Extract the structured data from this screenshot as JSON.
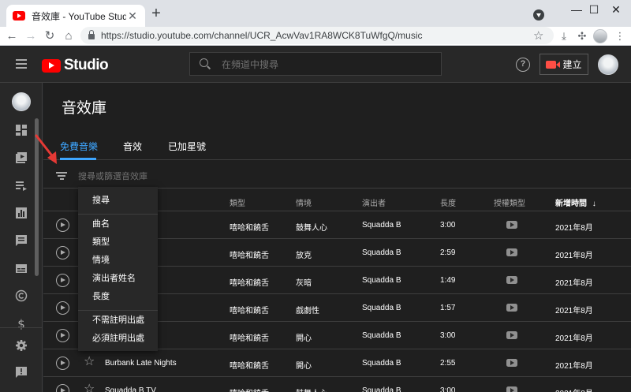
{
  "browser": {
    "tab_title": "音效庫 - YouTube Studio",
    "new_tab": "+",
    "win_min": "—",
    "win_max": "☐",
    "win_close": "✕",
    "url": "https://studio.youtube.com/channel/UCR_AcwVav1RA8WCK8TuWfgQ/music"
  },
  "header": {
    "logo_text": "Studio",
    "search_placeholder": "在頻道中搜尋",
    "create_label": "建立"
  },
  "page": {
    "title": "音效庫"
  },
  "tabs": [
    {
      "label": "免費音樂",
      "active": true
    },
    {
      "label": "音效",
      "active": false
    },
    {
      "label": "已加星號",
      "active": false
    }
  ],
  "filter": {
    "placeholder": "搜尋或篩選音效庫"
  },
  "columns": {
    "genre": "類型",
    "mood": "情境",
    "artist": "演出者",
    "duration": "長度",
    "license": "授權類型",
    "added": "新增時間"
  },
  "rows": [
    {
      "title": "l Extasy",
      "genre": "嘻哈和饒舌",
      "mood": "鼓舞人心",
      "artist": "Squadda B",
      "duration": "3:00",
      "added": "2021年8月"
    },
    {
      "title": "onaires",
      "genre": "嘻哈和饒舌",
      "mood": "放克",
      "artist": "Squadda B",
      "duration": "2:59",
      "added": "2021年8月"
    },
    {
      "title": "stle",
      "genre": "嘻哈和饒舌",
      "mood": "灰暗",
      "artist": "Squadda B",
      "duration": "1:49",
      "added": "2021年8月"
    },
    {
      "title": "o",
      "genre": "嘻哈和饒舌",
      "mood": "戲劇性",
      "artist": "Squadda B",
      "duration": "1:57",
      "added": "2021年8月"
    },
    {
      "title": "de",
      "genre": "嘻哈和饒舌",
      "mood": "開心",
      "artist": "Squadda B",
      "duration": "3:00",
      "added": "2021年8月"
    },
    {
      "title": "Burbank Late Nights",
      "genre": "嘻哈和饒舌",
      "mood": "開心",
      "artist": "Squadda B",
      "duration": "2:55",
      "added": "2021年8月"
    },
    {
      "title": "Squadda B TV",
      "genre": "嘻哈和饒舌",
      "mood": "鼓舞人心",
      "artist": "Squadda B",
      "duration": "3:00",
      "added": "2021年8月"
    }
  ],
  "menu": {
    "items": [
      "搜尋",
      "曲名",
      "類型",
      "情境",
      "演出者姓名",
      "長度",
      "不需註明出處",
      "必須註明出處"
    ]
  },
  "colors": {
    "accent": "#3ea6ff",
    "brand_red": "#ff0000",
    "annotation_arrow": "#e53935"
  }
}
